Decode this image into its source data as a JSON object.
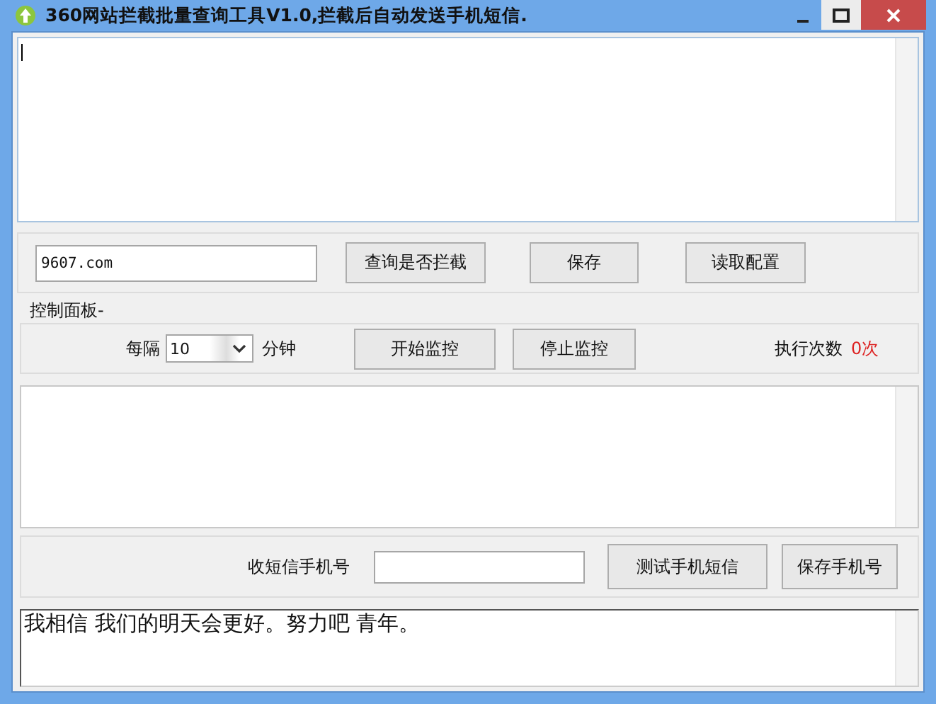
{
  "window": {
    "title": "360网站拦截批量查询工具V1.0,拦截后自动发送手机短信."
  },
  "query_panel": {
    "url_field": {
      "value": "9607.com"
    },
    "buttons": [
      "查询是否拦截",
      "保存",
      "读取配置"
    ]
  },
  "control_panel": {
    "title": "控制面板-",
    "interval_label": "每隔",
    "interval": "10",
    "unit": "分钟",
    "buttons": [
      "开始监控",
      "停止监控"
    ],
    "count_label": "执行次数",
    "count": "0次"
  },
  "sms_panel": {
    "phone_label": "收短信手机号",
    "buttons": [
      "测试手机短信",
      "保存手机号"
    ]
  },
  "message": {
    "text": "我相信 我们的明天会更好。努力吧 青年。"
  }
}
